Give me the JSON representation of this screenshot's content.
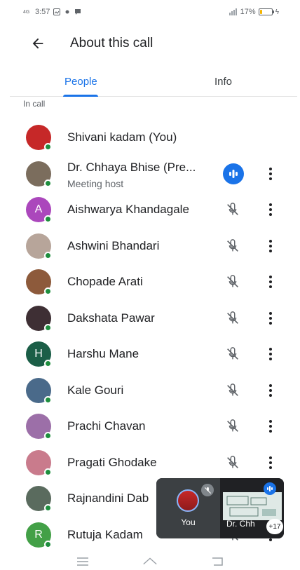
{
  "status_bar": {
    "network": "4G",
    "time": "3:57",
    "signal": "46",
    "battery_percent": "17%",
    "battery_level": 0.17
  },
  "header": {
    "title": "About this call",
    "back_icon": "arrow-back-icon"
  },
  "tabs": [
    {
      "label": "People",
      "selected": true
    },
    {
      "label": "Info",
      "selected": false
    }
  ],
  "section_label": "In call",
  "participants": [
    {
      "name": "Shivani kadam (You)",
      "subtitle": "",
      "avatar_color": "#c62828",
      "initial": "",
      "status": "none"
    },
    {
      "name": "Dr. Chhaya Bhise (Pre...",
      "subtitle": "Meeting host",
      "avatar_color": "#7b6d5d",
      "initial": "",
      "status": "speaking"
    },
    {
      "name": "Aishwarya Khandagale",
      "subtitle": "",
      "avatar_color": "#ab47bc",
      "initial": "A",
      "status": "muted"
    },
    {
      "name": "Ashwini Bhandari",
      "subtitle": "",
      "avatar_color": "#b7a59a",
      "initial": "",
      "status": "muted"
    },
    {
      "name": "Chopade Arati",
      "subtitle": "",
      "avatar_color": "#8d5a3b",
      "initial": "",
      "status": "muted"
    },
    {
      "name": "Dakshata Pawar",
      "subtitle": "",
      "avatar_color": "#3e2f34",
      "initial": "",
      "status": "muted"
    },
    {
      "name": "Harshu Mane",
      "subtitle": "",
      "avatar_color": "#1b5e47",
      "initial": "H",
      "status": "muted"
    },
    {
      "name": "Kale Gouri",
      "subtitle": "",
      "avatar_color": "#4a6a8a",
      "initial": "",
      "status": "muted"
    },
    {
      "name": "Prachi Chavan",
      "subtitle": "",
      "avatar_color": "#9c6fa8",
      "initial": "",
      "status": "muted"
    },
    {
      "name": "Pragati Ghodake",
      "subtitle": "",
      "avatar_color": "#c97b8c",
      "initial": "",
      "status": "muted"
    },
    {
      "name": "Rajnandini Dab",
      "subtitle": "",
      "avatar_color": "#5a6b5e",
      "initial": "",
      "status": "muted"
    },
    {
      "name": "Rutuja Kadam",
      "subtitle": "",
      "avatar_color": "#43a047",
      "initial": "R",
      "status": "muted"
    }
  ],
  "pip": {
    "self_label": "You",
    "host_label": "Dr. Chh",
    "extra_count": "+17"
  },
  "colors": {
    "accent": "#1a73e8",
    "presence": "#1e8e3e"
  }
}
